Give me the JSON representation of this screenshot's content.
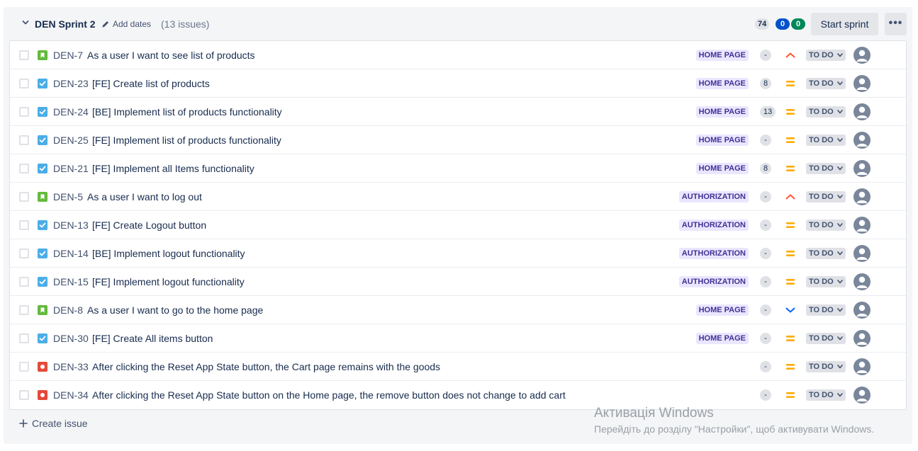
{
  "sprint": {
    "name": "DEN Sprint 2",
    "add_dates_label": "Add dates",
    "issue_count": "(13 issues)",
    "badges": {
      "not_started": "74",
      "in_progress": "0",
      "done": "0"
    },
    "start_button_label": "Start sprint",
    "more_button_label": "•••",
    "create_issue_label": "Create issue"
  },
  "issues": [
    {
      "key": "DEN-7",
      "type": "story",
      "title": "As a user I want to see list of products",
      "epic": "HOME PAGE",
      "estimate": "-",
      "priority": "high",
      "status": "TO DO"
    },
    {
      "key": "DEN-23",
      "type": "task",
      "title": "[FE] Create list of products",
      "epic": "HOME PAGE",
      "estimate": "8",
      "priority": "medium",
      "status": "TO DO"
    },
    {
      "key": "DEN-24",
      "type": "task",
      "title": "[BE] Implement list of products functionality",
      "epic": "HOME PAGE",
      "estimate": "13",
      "priority": "medium",
      "status": "TO DO"
    },
    {
      "key": "DEN-25",
      "type": "task",
      "title": "[FE] Implement list of products functionality",
      "epic": "HOME PAGE",
      "estimate": "-",
      "priority": "medium",
      "status": "TO DO"
    },
    {
      "key": "DEN-21",
      "type": "task",
      "title": "[FE] Implement all Items functionality",
      "epic": "HOME PAGE",
      "estimate": "8",
      "priority": "medium",
      "status": "TO DO"
    },
    {
      "key": "DEN-5",
      "type": "story",
      "title": "As a user I want to log out",
      "epic": "AUTHORIZATION",
      "estimate": "-",
      "priority": "high",
      "status": "TO DO"
    },
    {
      "key": "DEN-13",
      "type": "task",
      "title": "[FE] Create Logout button",
      "epic": "AUTHORIZATION",
      "estimate": "-",
      "priority": "medium",
      "status": "TO DO"
    },
    {
      "key": "DEN-14",
      "type": "task",
      "title": "[BE] Implement logout functionality",
      "epic": "AUTHORIZATION",
      "estimate": "-",
      "priority": "medium",
      "status": "TO DO"
    },
    {
      "key": "DEN-15",
      "type": "task",
      "title": "[FE] Implement logout functionality",
      "epic": "AUTHORIZATION",
      "estimate": "-",
      "priority": "medium",
      "status": "TO DO"
    },
    {
      "key": "DEN-8",
      "type": "story",
      "title": "As a user I want to go to the home page",
      "epic": "HOME PAGE",
      "estimate": "-",
      "priority": "low",
      "status": "TO DO"
    },
    {
      "key": "DEN-30",
      "type": "task",
      "title": "[FE] Create All items button",
      "epic": "HOME PAGE",
      "estimate": "-",
      "priority": "medium",
      "status": "TO DO"
    },
    {
      "key": "DEN-33",
      "type": "bug",
      "title": "After clicking the Reset App State button, the Cart page remains with the goods",
      "epic": "",
      "estimate": "-",
      "priority": "medium",
      "status": "TO DO"
    },
    {
      "key": "DEN-34",
      "type": "bug",
      "title": "After clicking the Reset App State button on the Home page, the remove button does not change to add cart",
      "epic": "",
      "estimate": "-",
      "priority": "medium",
      "status": "TO DO"
    }
  ],
  "watermark": {
    "line1": "Активація Windows",
    "line2": "Перейдіть до розділу \"Настройки\", щоб активувати Windows."
  },
  "colors": {
    "story": "#63ba3c",
    "task": "#4bade8",
    "bug": "#e5493a",
    "priority_high": "#ff5630",
    "priority_medium": "#ffab00",
    "priority_low": "#0065ff",
    "epic_bg": "#eae6ff",
    "epic_text": "#403294"
  }
}
